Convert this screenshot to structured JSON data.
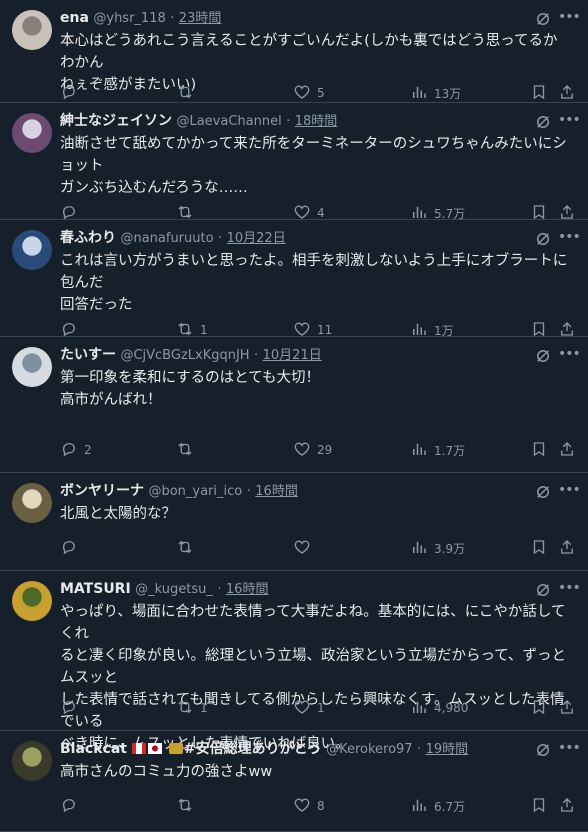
{
  "tweets": [
    {
      "name": "ena",
      "handle": "@yhsr_118",
      "time": "23時間",
      "text": "本心はどうあれこう言えることがすごいんだよ(しかも裏ではどう思ってるかわかん\nねぇぞ感がまたいい)",
      "replies": "",
      "retweets": "",
      "likes": "5",
      "views": "13万"
    },
    {
      "name": "紳士なジェイソン",
      "handle": "@LaevaChannel",
      "time": "18時間",
      "text": "油断させて舐めてかかって来た所をターミネーターのシュワちゃんみたいにショット\nガンぶち込むんだろうな……",
      "replies": "",
      "retweets": "",
      "likes": "4",
      "views": "5.7万"
    },
    {
      "name": "春ふわり",
      "handle": "@nanafuruuto",
      "time": "10月22日",
      "text": "これは言い方がうまいと思ったよ。相手を刺激しないよう上手にオブラートに包んだ\n回答だった",
      "replies": "",
      "retweets": "1",
      "likes": "11",
      "views": "1万"
    },
    {
      "name": "たいすー",
      "handle": "@CjVcBGzLxKgqnJH",
      "time": "10月21日",
      "text": "第一印象を柔和にするのはとても大切！\n高市がんばれ！",
      "replies": "2",
      "retweets": "",
      "likes": "29",
      "views": "1.7万"
    },
    {
      "name": "ボンヤリーナ",
      "handle": "@bon_yari_ico",
      "time": "16時間",
      "text": "北風と太陽的な？",
      "replies": "",
      "retweets": "",
      "likes": "",
      "views": "3.9万"
    },
    {
      "name": "MATSURI",
      "handle": "@_kugetsu_",
      "time": "16時間",
      "text": "やっぱり、場面に合わせた表情って大事だよね。基本的には、にこやか話してくれ\nると凄く印象が良い。総理という立場、政治家という立場だからって、ずっとムスッと\nした表情で話されても聞きしてる側からしたら興味なくす。ムスッとした表情でいる\nべき時に、ムスッとした表情でいれば良い。",
      "replies": "",
      "retweets": "1",
      "likes": "1",
      "views": "4,980"
    },
    {
      "name": "Blackcat",
      "name_suffix": "#安倍総理ありがとう",
      "handle": "@Kerokero97",
      "time": "19時間",
      "text": "高市さんのコミュ力の強さよww",
      "replies": "",
      "retweets": "",
      "likes": "8",
      "views": "6.7万"
    }
  ],
  "ui": {
    "sep": "·",
    "more": "•••",
    "icons": [
      "reply-icon",
      "retweet-icon",
      "like-icon",
      "views-icon",
      "bookmark-icon",
      "share-icon",
      "grok-icon"
    ],
    "colors": {
      "bg": "#15202b",
      "text": "#e7e9ea",
      "muted": "#8b98a5",
      "border": "#38444d"
    }
  }
}
